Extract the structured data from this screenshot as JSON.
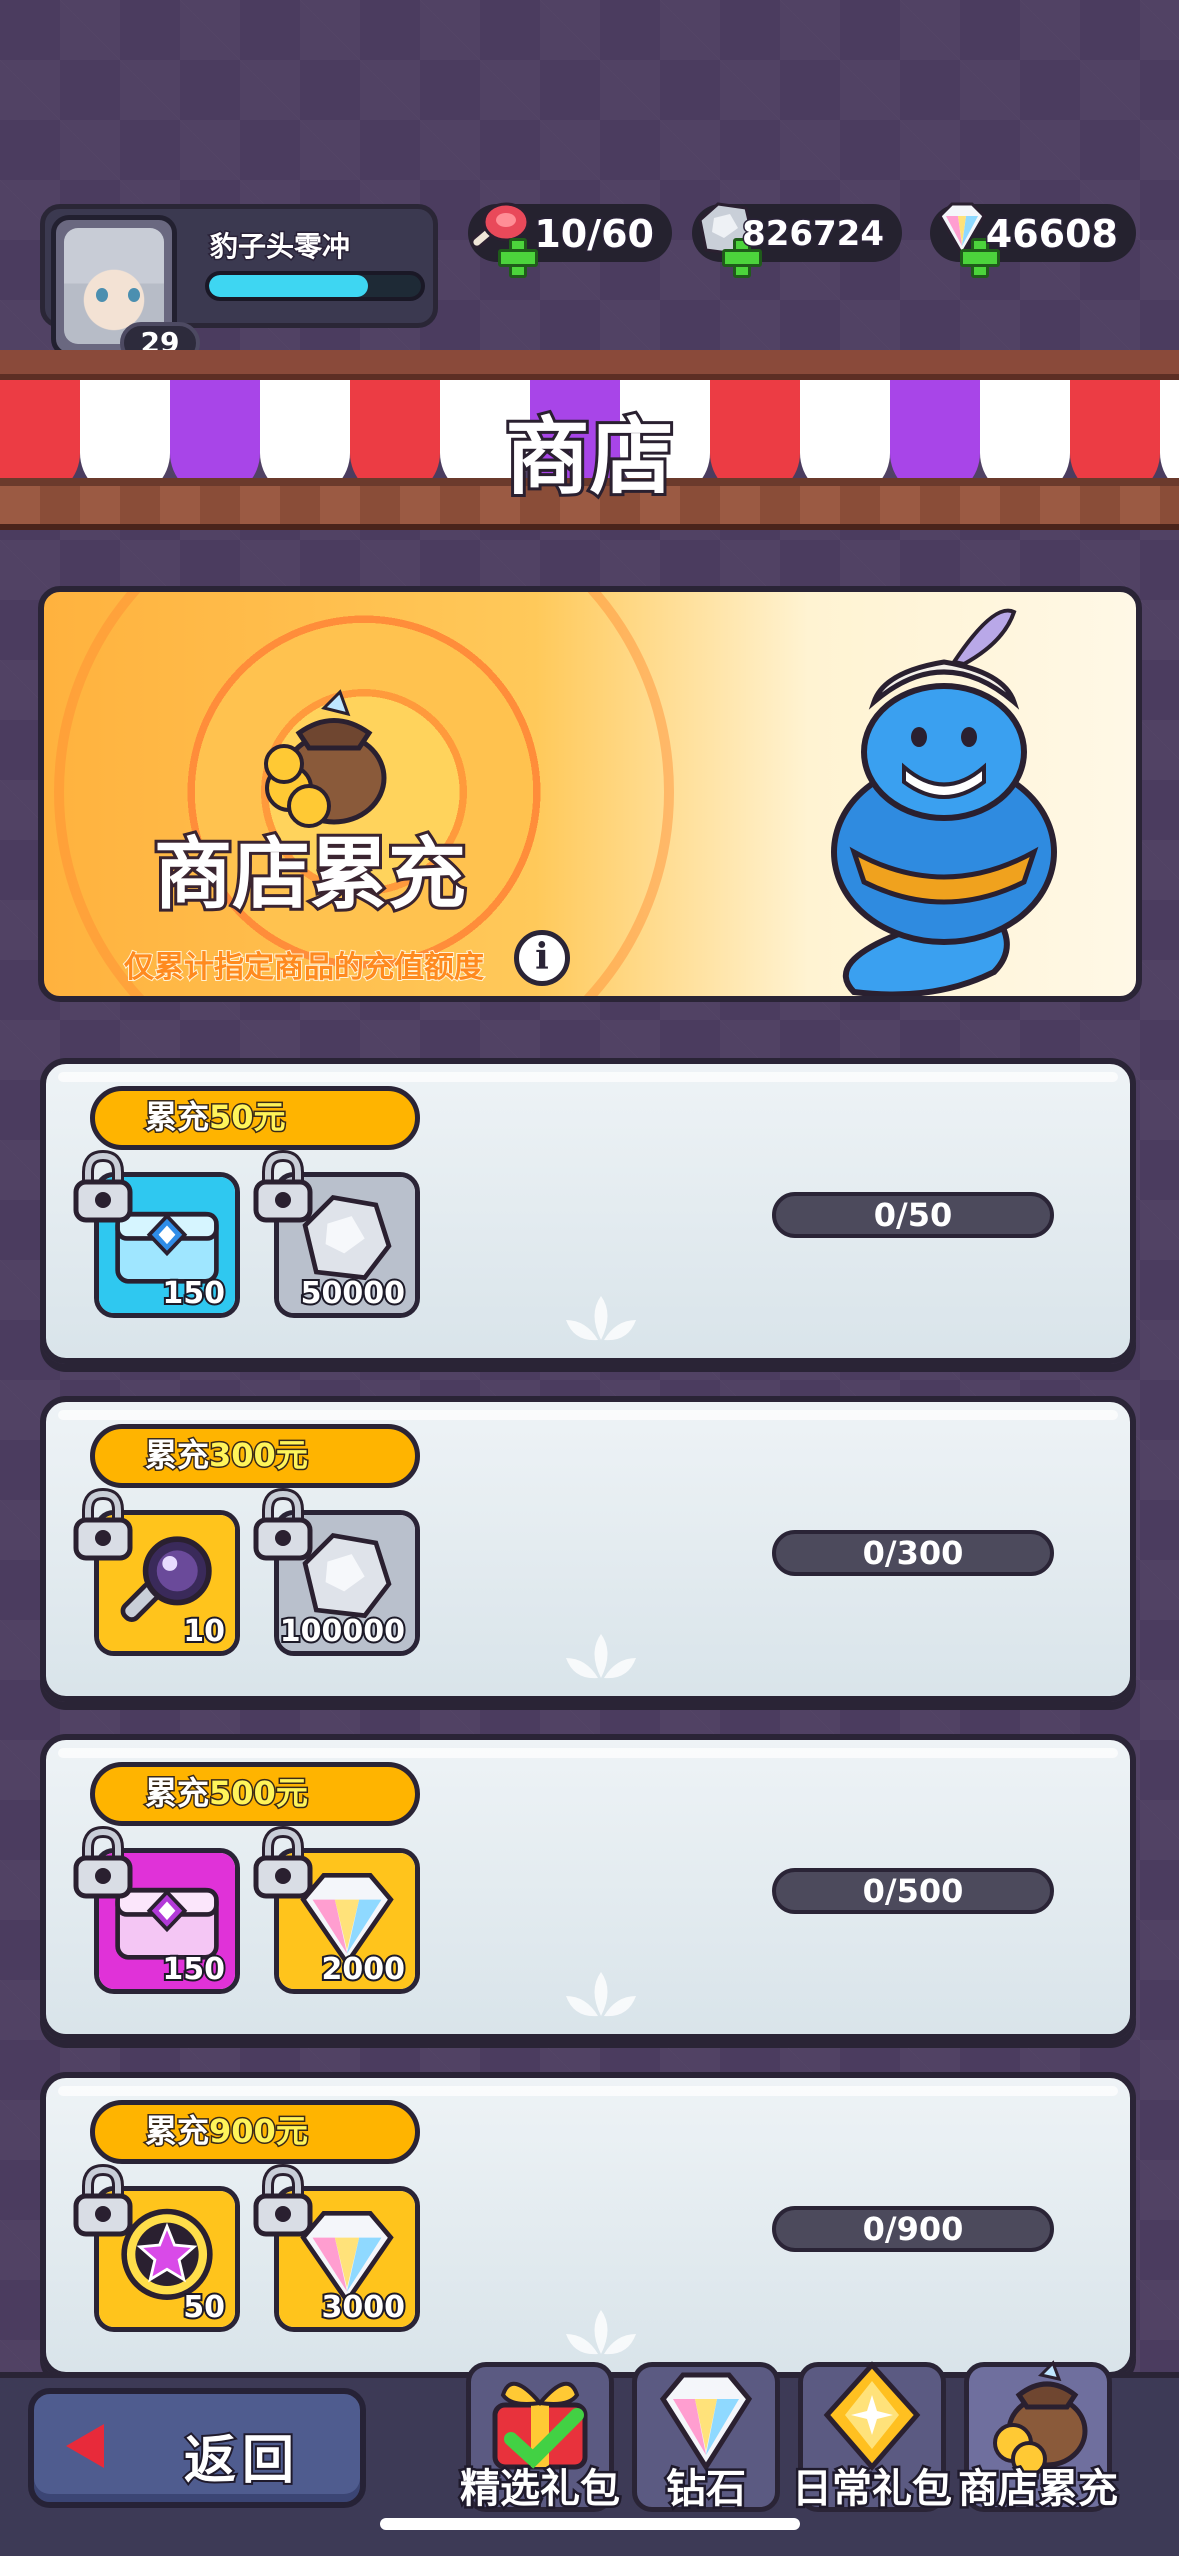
{
  "player": {
    "name": "豹子头零冲",
    "level": "29",
    "xp_progress": 0.75
  },
  "resources": {
    "stamina": {
      "value": "10/60",
      "icon": "meat-icon"
    },
    "silver": {
      "value": "826724",
      "icon": "silver-ore-icon"
    },
    "diamonds": {
      "value": "46608",
      "icon": "diamond-icon"
    }
  },
  "header": {
    "title": "商店"
  },
  "banner": {
    "title": "商店累充",
    "subtitle": "仅累计指定商品的充值额度",
    "info_symbol": "i"
  },
  "tiers": [
    {
      "prefix": "累充",
      "amount": "50元",
      "progress": "0/50",
      "rewards": [
        {
          "icon": "cyan-chest-icon",
          "qty": "150"
        },
        {
          "icon": "silver-ore-icon",
          "qty": "50000"
        }
      ]
    },
    {
      "prefix": "累充",
      "amount": "300元",
      "progress": "0/300",
      "rewards": [
        {
          "icon": "magnifier-key-icon",
          "qty": "10"
        },
        {
          "icon": "silver-ore-icon",
          "qty": "100000"
        }
      ]
    },
    {
      "prefix": "累充",
      "amount": "500元",
      "progress": "0/500",
      "rewards": [
        {
          "icon": "magenta-chest-icon",
          "qty": "150"
        },
        {
          "icon": "diamond-icon",
          "qty": "2000"
        }
      ]
    },
    {
      "prefix": "累充",
      "amount": "900元",
      "progress": "0/900",
      "rewards": [
        {
          "icon": "star-medal-icon",
          "qty": "50"
        },
        {
          "icon": "diamond-icon",
          "qty": "3000"
        }
      ]
    }
  ],
  "nav": {
    "back_label": "返回",
    "tabs": [
      {
        "label": "精选礼包",
        "icon": "gift-icon"
      },
      {
        "label": "钻石",
        "icon": "diamond-icon"
      },
      {
        "label": "日常礼包",
        "icon": "gold-gem-icon"
      },
      {
        "label": "商店累充",
        "icon": "coin-bag-icon"
      }
    ]
  },
  "colors": {
    "accent": "#ffb400",
    "background": "#4b3c5f",
    "card": "#e4ecf0",
    "xp_bar": "#3ed6f2",
    "plus_green": "#4cd43c"
  }
}
